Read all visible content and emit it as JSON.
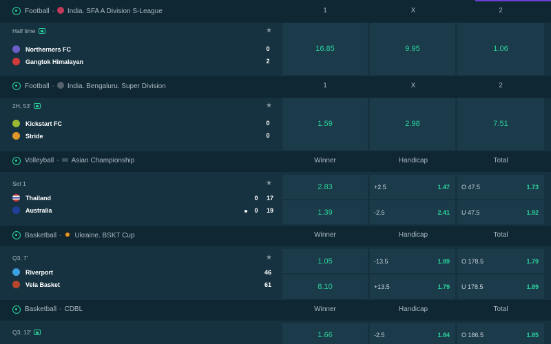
{
  "sections": [
    {
      "sport": "Football",
      "league": "India. SFA A Division S-League",
      "columns": [
        "1",
        "X",
        "2"
      ],
      "sport_icon": "football-icon",
      "period": "Half time",
      "teams": [
        {
          "name": "Northerners FC",
          "score": "0"
        },
        {
          "name": "Gangtok Himalayan",
          "score": "2"
        }
      ],
      "odds": [
        "16.85",
        "9.95",
        "1.06"
      ]
    },
    {
      "sport": "Football",
      "league": "India. Bengaluru. Super Division",
      "columns": [
        "1",
        "X",
        "2"
      ],
      "sport_icon": "football-icon",
      "period": "2H, 53'",
      "teams": [
        {
          "name": "Kickstart FC",
          "score": "0"
        },
        {
          "name": "Stride",
          "score": "0"
        }
      ],
      "odds": [
        "1.59",
        "2.98",
        "7.51"
      ]
    },
    {
      "sport": "Volleyball",
      "league": "Asian Championship",
      "columns": [
        "Winner",
        "Handicap",
        "Total"
      ],
      "sport_icon": "volleyball-icon",
      "period": "Set 1",
      "teams": [
        {
          "name": "Thailand",
          "set": "0",
          "score": "17"
        },
        {
          "name": "Australia",
          "set": "0",
          "score": "19"
        }
      ],
      "rows": [
        {
          "winner": "2.83",
          "hcp": "+2.5",
          "hcp_odd": "1.47",
          "total": "O 47.5",
          "total_odd": "1.73"
        },
        {
          "winner": "1.39",
          "hcp": "-2.5",
          "hcp_odd": "2.41",
          "total": "U 47.5",
          "total_odd": "1.92"
        }
      ]
    },
    {
      "sport": "Basketball",
      "league": "Ukraine. BSKT Cup",
      "columns": [
        "Winner",
        "Handicap",
        "Total"
      ],
      "sport_icon": "basketball-icon",
      "period": "Q3, 7'",
      "teams": [
        {
          "name": "Riverport",
          "score": "46"
        },
        {
          "name": "Vela Basket",
          "score": "61"
        }
      ],
      "rows": [
        {
          "winner": "1.05",
          "hcp": "-13.5",
          "hcp_odd": "1.89",
          "total": "O 178.5",
          "total_odd": "1.79"
        },
        {
          "winner": "8.10",
          "hcp": "+13.5",
          "hcp_odd": "1.79",
          "total": "U 178.5",
          "total_odd": "1.89"
        }
      ]
    },
    {
      "sport": "Basketball",
      "league": "CDBL",
      "columns": [
        "Winner",
        "Handicap",
        "Total"
      ],
      "sport_icon": "basketball-icon",
      "period": "Q3, 12'",
      "rows": [
        {
          "winner": "1.66",
          "hcp": "-2.5",
          "hcp_odd": "1.84",
          "total": "O 186.5",
          "total_odd": "1.85"
        }
      ]
    }
  ],
  "separator": "-",
  "colors": {
    "accent": "#2bd49c",
    "background": "#0f2733",
    "card": "#163240",
    "cell": "#1b3a4a"
  }
}
